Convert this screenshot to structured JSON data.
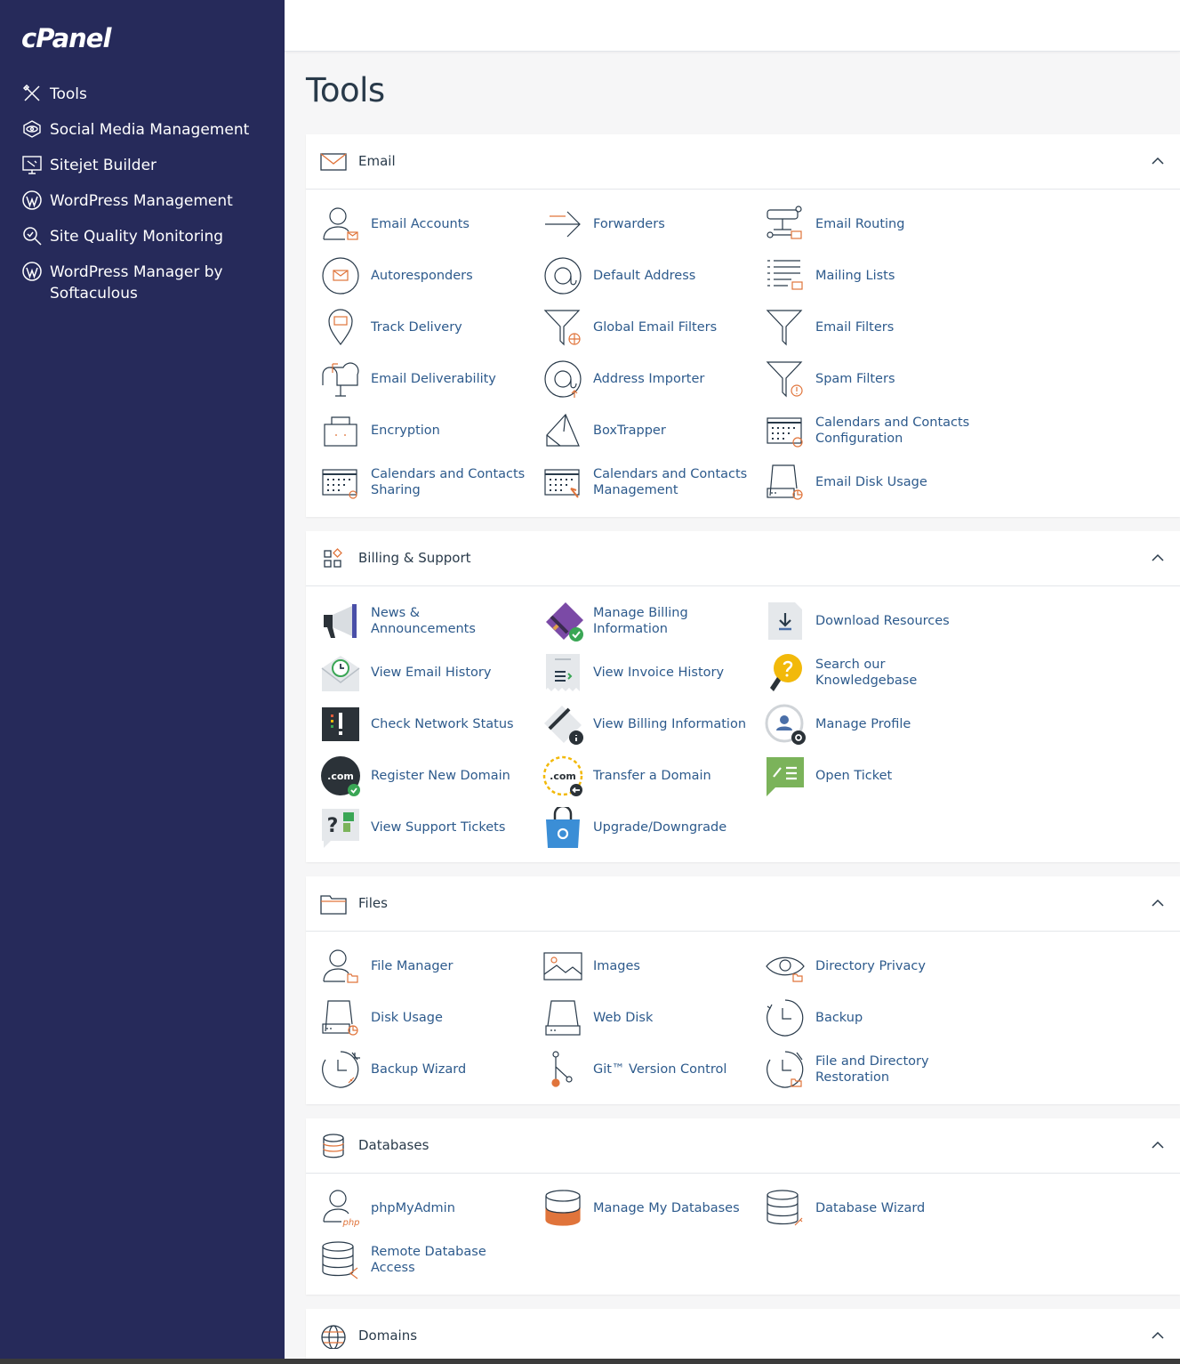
{
  "brand": "cPanel",
  "sidebar": {
    "items": [
      {
        "label": "Tools",
        "icon": "tools-icon"
      },
      {
        "label": "Social Media Management",
        "icon": "social-media-icon"
      },
      {
        "label": "Sitejet Builder",
        "icon": "sitejet-icon"
      },
      {
        "label": "WordPress Management",
        "icon": "wordpress-icon"
      },
      {
        "label": "Site Quality Monitoring",
        "icon": "site-quality-icon"
      },
      {
        "label": "WordPress Manager by Softaculous",
        "icon": "wordpress-icon"
      }
    ]
  },
  "page": {
    "title": "Tools"
  },
  "sections": [
    {
      "title": "Email",
      "items": [
        "Email Accounts",
        "Forwarders",
        "Email Routing",
        "Autoresponders",
        "Default Address",
        "Mailing Lists",
        "Track Delivery",
        "Global Email Filters",
        "Email Filters",
        "Email Deliverability",
        "Address Importer",
        "Spam Filters",
        "Encryption",
        "BoxTrapper",
        "Calendars and Contacts Configuration",
        "Calendars and Contacts Sharing",
        "Calendars and Contacts Management",
        "Email Disk Usage"
      ]
    },
    {
      "title": "Billing & Support",
      "items": [
        "News & Announcements",
        "Manage Billing Information",
        "Download Resources",
        "View Email History",
        "View Invoice History",
        "Search our Knowledgebase",
        "Check Network Status",
        "View Billing Information",
        "Manage Profile",
        "Register New Domain",
        "Transfer a Domain",
        "Open Ticket",
        "View Support Tickets",
        "Upgrade/Downgrade"
      ]
    },
    {
      "title": "Files",
      "items": [
        "File Manager",
        "Images",
        "Directory Privacy",
        "Disk Usage",
        "Web Disk",
        "Backup",
        "Backup Wizard",
        "Git™ Version Control",
        "File and Directory Restoration"
      ]
    },
    {
      "title": "Databases",
      "items": [
        "phpMyAdmin",
        "Manage My Databases",
        "Database Wizard",
        "Remote Database Access"
      ]
    },
    {
      "title": "Domains",
      "items": []
    }
  ],
  "icon_text": {
    "com": ".com",
    "php": "php"
  },
  "colors": {
    "sidebar": "#262a5a",
    "link": "#2d5a8c",
    "accent": "#e0743b"
  }
}
